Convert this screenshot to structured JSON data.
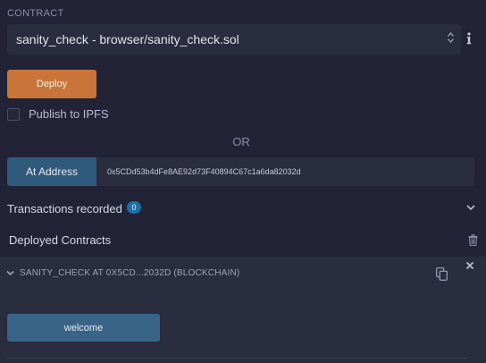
{
  "contract": {
    "section_label": "CONTRACT",
    "selected": "sanity_check - browser/sanity_check.sol"
  },
  "deploy": {
    "button_label": "Deploy",
    "button_color": "#c97539"
  },
  "publish": {
    "label": "Publish to IPFS",
    "checked": false
  },
  "or_text": "OR",
  "at_address": {
    "button_label": "At Address",
    "input_value": "0x5CDd53b4dFe8AE92d73F40894C67c1a6da82032d"
  },
  "transactions": {
    "label": "Transactions recorded",
    "count": "0"
  },
  "deployed": {
    "label": "Deployed Contracts",
    "instance_title": "SANITY_CHECK AT 0X5CD...2032D (BLOCKCHAIN)",
    "function_button": "welcome"
  },
  "icons": {
    "select": "select-arrows-icon",
    "info": "info-icon",
    "chevron": "chevron-down-icon",
    "trash": "trash-icon",
    "copy": "copy-icon",
    "close": "close-icon"
  }
}
